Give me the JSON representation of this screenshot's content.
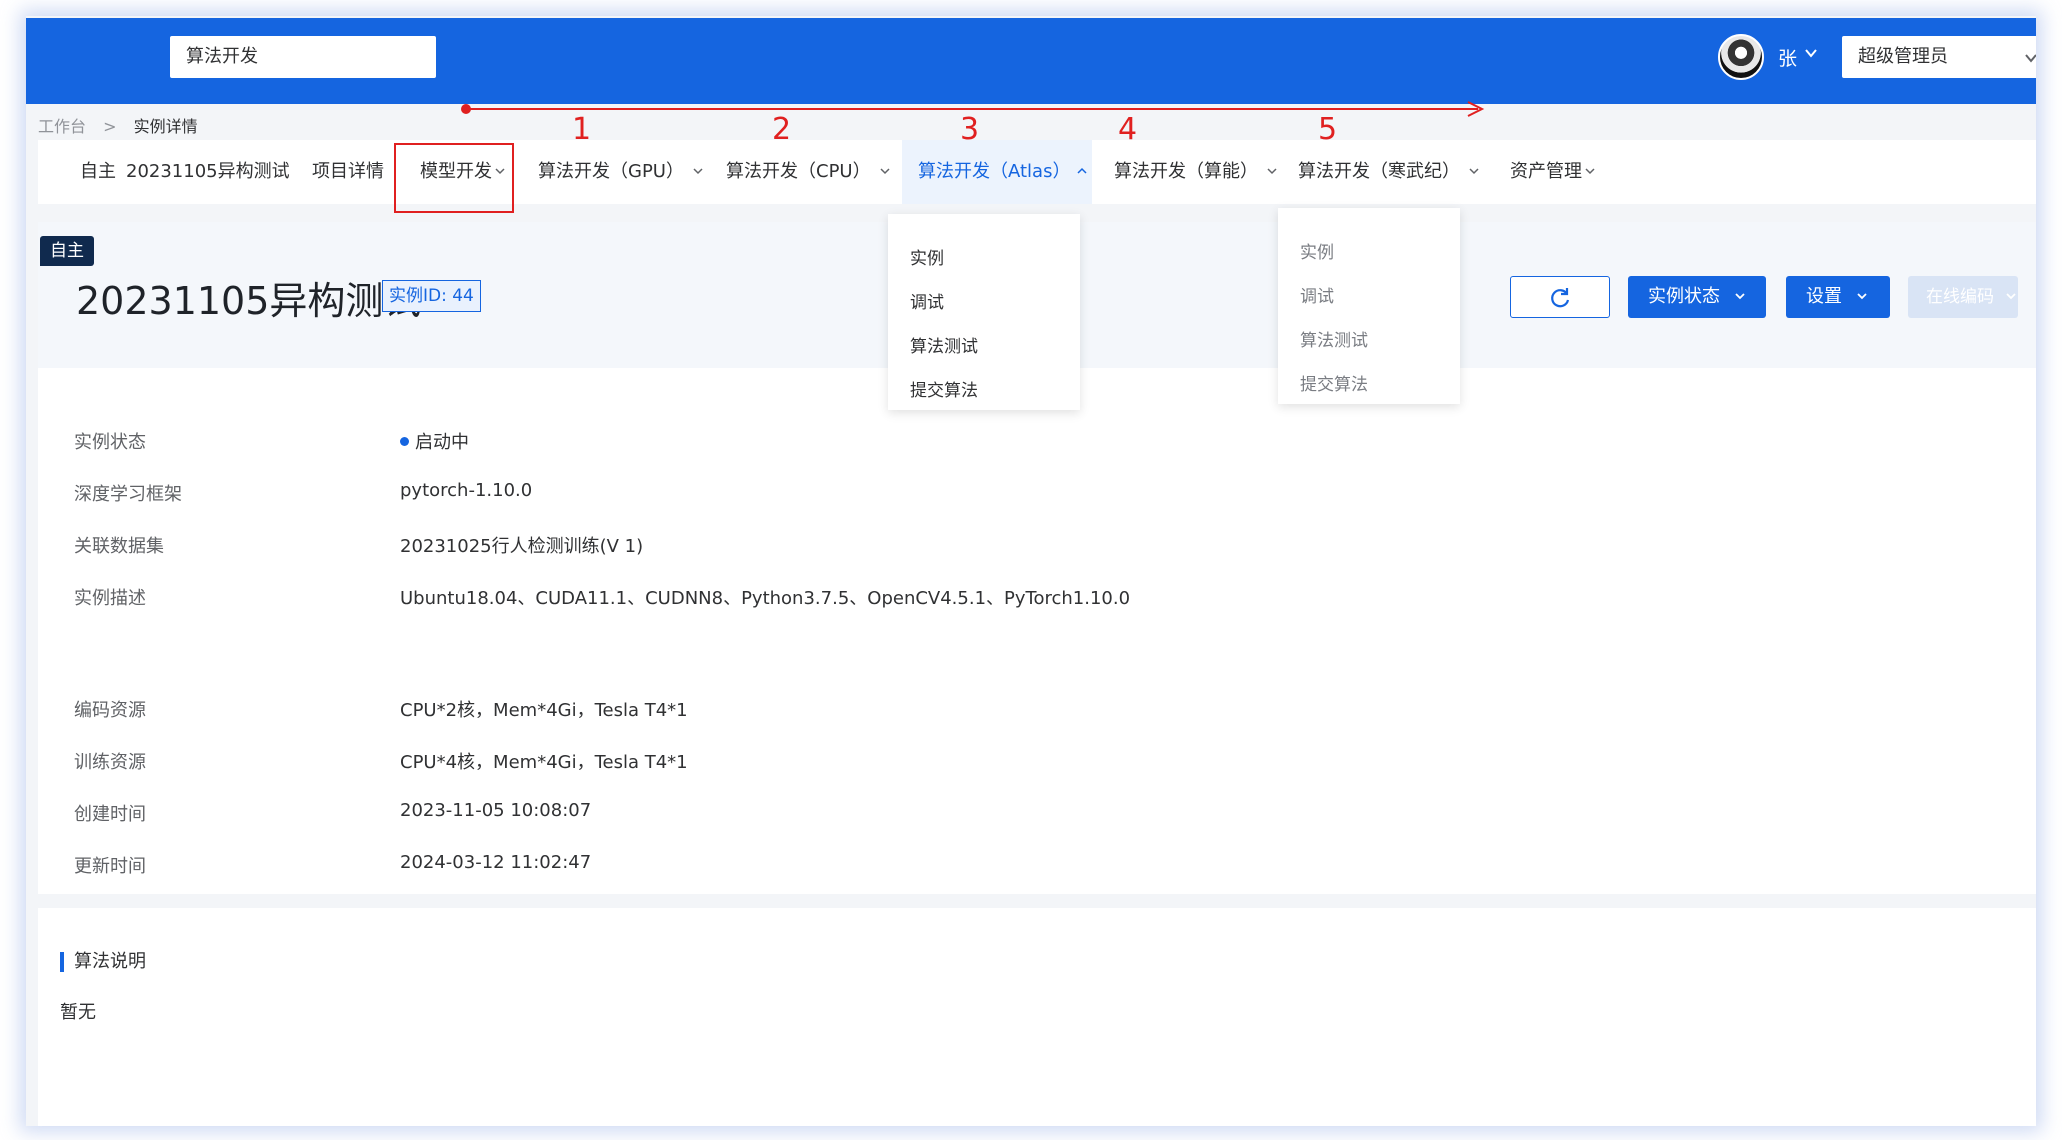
{
  "header": {
    "search_value": "算法开发",
    "user_name": "张",
    "role": "超级管理员"
  },
  "breadcrumb": {
    "items": [
      "工作台",
      "实例详情"
    ],
    "separator": ">"
  },
  "nav": {
    "instance_tag": "自主",
    "instance_name": "20231105异构测试",
    "items": [
      "项目详情",
      "模型开发",
      "算法开发（GPU）",
      "算法开发（CPU）",
      "算法开发（Atlas）",
      "算法开发（算能）",
      "算法开发（寒武纪）",
      "资产管理"
    ],
    "active_item": "算法开发（Atlas）"
  },
  "annotations": {
    "step_numbers": [
      "1",
      "2",
      "3",
      "4",
      "5"
    ],
    "color": "#e02020"
  },
  "atlas_menu": {
    "items": [
      "实例",
      "调试",
      "算法测试",
      "提交算法"
    ]
  },
  "cambricon_menu": {
    "items": [
      "实例",
      "调试",
      "算法测试",
      "提交算法"
    ]
  },
  "instance": {
    "badge": "自主",
    "title": "20231105异构测试",
    "id_label": "实例ID: 44",
    "buttons": {
      "refresh_icon": "refresh-icon",
      "status": "实例状态",
      "settings": "设置",
      "online_coding": "在线编码"
    }
  },
  "details": [
    {
      "label": "实例状态",
      "value": "启动中"
    },
    {
      "label": "深度学习框架",
      "value": "pytorch-1.10.0"
    },
    {
      "label": "关联数据集",
      "value": "20231025行人检测训练(V 1)"
    },
    {
      "label": "实例描述",
      "value": "Ubuntu18.04、CUDA11.1、CUDNN8、Python3.7.5、OpenCV4.5.1、PyTorch1.10.0"
    },
    {
      "label": "编码资源",
      "value": "CPU*2核，Mem*4Gi，Tesla T4*1"
    },
    {
      "label": "训练资源",
      "value": "CPU*4核，Mem*4Gi，Tesla T4*1"
    },
    {
      "label": "创建时间",
      "value": "2023-11-05 10:08:07"
    },
    {
      "label": "更新时间",
      "value": "2024-03-12 11:02:47"
    }
  ],
  "algorithm": {
    "title": "算法说明",
    "body": "暂无"
  },
  "colors": {
    "primary": "#1565e0",
    "annotation_red": "#e02020",
    "badge_dark": "#102a4e"
  }
}
